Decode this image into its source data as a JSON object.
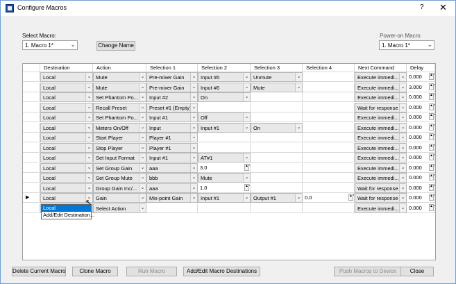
{
  "window": {
    "title": "Configure Macros",
    "help": "?",
    "close": "✕"
  },
  "select_macro": {
    "label": "Select Macro:",
    "value": "1. Macro 1*"
  },
  "change_name": "Change Name",
  "power_on": {
    "label": "Power-on Macro",
    "value": "1. Macro 1*"
  },
  "columns": [
    "Destination",
    "Action",
    "Selection 1",
    "Selection 2",
    "Selection 3",
    "Selection 4",
    "Next Command",
    "Delay"
  ],
  "rows": [
    {
      "dest": "Local",
      "action": "Mute",
      "s1": "Pre-mixer Gain",
      "s2": "Input #6",
      "s3": "Unmute",
      "s4": "",
      "next": "Execute immedi...",
      "delay": "0.000"
    },
    {
      "dest": "Local",
      "action": "Mute",
      "s1": "Pre-mixer Gain",
      "s2": "Input #6",
      "s3": "Mute",
      "s4": "",
      "next": "Execute immedi...",
      "delay": "3.000"
    },
    {
      "dest": "Local",
      "action": "Set Phantom Po...",
      "s1": "Input #2",
      "s2": "On",
      "s3": "",
      "s4": "",
      "next": "Execute immedi...",
      "delay": "0.000"
    },
    {
      "dest": "Local",
      "action": "Recall Preset",
      "s1": "Preset #1 (Empty)",
      "s2": "",
      "s3": "",
      "s4": "",
      "next": "Wait for response",
      "delay": "0.000"
    },
    {
      "dest": "Local",
      "action": "Set Phantom Po...",
      "s1": "Input #1",
      "s2": "Off",
      "s3": "",
      "s4": "",
      "next": "Execute immedi...",
      "delay": "0.000"
    },
    {
      "dest": "Local",
      "action": "Meters On/Off",
      "s1": "Input",
      "s2": "Input #1",
      "s3": "On",
      "s4": "",
      "next": "Execute immedi...",
      "delay": "0.000"
    },
    {
      "dest": "Local",
      "action": "Start Player",
      "s1": "Player #1",
      "s2": "",
      "s3": "",
      "s4": "",
      "next": "Execute immedi...",
      "delay": "0.000"
    },
    {
      "dest": "Local",
      "action": "Stop Player",
      "s1": "Player #1",
      "s2": "",
      "s3": "",
      "s4": "",
      "next": "Execute immedi...",
      "delay": "0.000"
    },
    {
      "dest": "Local",
      "action": "Set Input Format",
      "s1": "Input #1",
      "s2": "AT#1",
      "s3": "",
      "s4": "",
      "next": "Execute immedi...",
      "delay": "0.000"
    },
    {
      "dest": "Local",
      "action": "Set Group Gain",
      "s1": "aaa",
      "s2": "3.0",
      "s3": "",
      "s4": "",
      "next": "Execute immedi...",
      "delay": "0.000"
    },
    {
      "dest": "Local",
      "action": "Set Group Mute",
      "s1": "bbb",
      "s2": "Mute",
      "s3": "",
      "s4": "",
      "next": "Execute immedi...",
      "delay": "0.000"
    },
    {
      "dest": "Local",
      "action": "Group Gain Inc/...",
      "s1": "aaa",
      "s2": "1.0",
      "s3": "",
      "s4": "",
      "next": "Wait for response",
      "delay": "0.000"
    },
    {
      "dest": "Local",
      "action": "Gain",
      "s1": "Mix-point Gain",
      "s2": "Input #1",
      "s3": "Output #1",
      "s4": "0.0",
      "next": "Wait for response",
      "delay": "0.000"
    },
    {
      "dest": "",
      "action": "Select Action",
      "s1": "",
      "s2": "",
      "s3": "",
      "s4": "",
      "next": "Execute immedi...",
      "delay": "0.000"
    }
  ],
  "dropdown": [
    "Local",
    "Add/Edit Destination..."
  ],
  "buttons": {
    "delete": "Delete Current Macro",
    "clone": "Clone Macro",
    "run": "Run Macro",
    "add_edit": "Add/Edit Macro Destinations",
    "push": "Push Macros to Device",
    "close": "Close"
  }
}
